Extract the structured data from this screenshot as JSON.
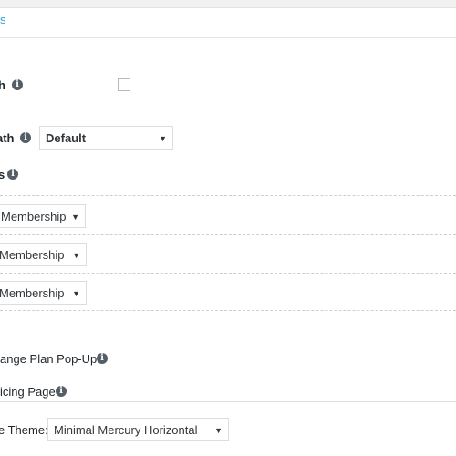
{
  "header": {
    "tab_fragment": "s"
  },
  "settings": {
    "row1_label": "h",
    "row2_label": "ath",
    "row2_select": "Default",
    "row3_label": "s",
    "membership_selects": [
      "Membership",
      "Membership",
      " Membership"
    ],
    "change_plan_label": "ange Plan Pop-Up",
    "pricing_page_label": "icing Page",
    "theme_label": "e Theme:",
    "theme_select": "Minimal Mercury Horizontal"
  },
  "icons": {
    "info": "info-icon",
    "dropdown": "triangle-down-icon"
  }
}
